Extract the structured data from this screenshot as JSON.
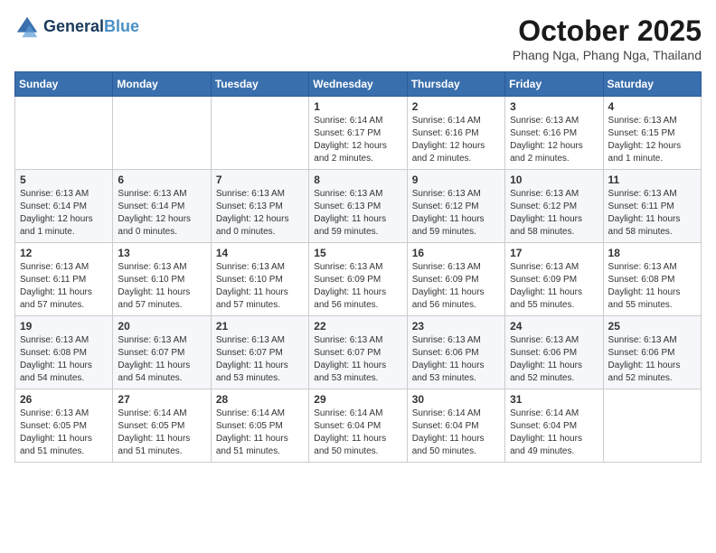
{
  "header": {
    "logo_line1": "General",
    "logo_line2": "Blue",
    "month": "October 2025",
    "location": "Phang Nga, Phang Nga, Thailand"
  },
  "weekdays": [
    "Sunday",
    "Monday",
    "Tuesday",
    "Wednesday",
    "Thursday",
    "Friday",
    "Saturday"
  ],
  "weeks": [
    [
      {
        "day": "",
        "content": ""
      },
      {
        "day": "",
        "content": ""
      },
      {
        "day": "",
        "content": ""
      },
      {
        "day": "1",
        "content": "Sunrise: 6:14 AM\nSunset: 6:17 PM\nDaylight: 12 hours and 2 minutes."
      },
      {
        "day": "2",
        "content": "Sunrise: 6:14 AM\nSunset: 6:16 PM\nDaylight: 12 hours and 2 minutes."
      },
      {
        "day": "3",
        "content": "Sunrise: 6:13 AM\nSunset: 6:16 PM\nDaylight: 12 hours and 2 minutes."
      },
      {
        "day": "4",
        "content": "Sunrise: 6:13 AM\nSunset: 6:15 PM\nDaylight: 12 hours and 1 minute."
      }
    ],
    [
      {
        "day": "5",
        "content": "Sunrise: 6:13 AM\nSunset: 6:14 PM\nDaylight: 12 hours and 1 minute."
      },
      {
        "day": "6",
        "content": "Sunrise: 6:13 AM\nSunset: 6:14 PM\nDaylight: 12 hours and 0 minutes."
      },
      {
        "day": "7",
        "content": "Sunrise: 6:13 AM\nSunset: 6:13 PM\nDaylight: 12 hours and 0 minutes."
      },
      {
        "day": "8",
        "content": "Sunrise: 6:13 AM\nSunset: 6:13 PM\nDaylight: 11 hours and 59 minutes."
      },
      {
        "day": "9",
        "content": "Sunrise: 6:13 AM\nSunset: 6:12 PM\nDaylight: 11 hours and 59 minutes."
      },
      {
        "day": "10",
        "content": "Sunrise: 6:13 AM\nSunset: 6:12 PM\nDaylight: 11 hours and 58 minutes."
      },
      {
        "day": "11",
        "content": "Sunrise: 6:13 AM\nSunset: 6:11 PM\nDaylight: 11 hours and 58 minutes."
      }
    ],
    [
      {
        "day": "12",
        "content": "Sunrise: 6:13 AM\nSunset: 6:11 PM\nDaylight: 11 hours and 57 minutes."
      },
      {
        "day": "13",
        "content": "Sunrise: 6:13 AM\nSunset: 6:10 PM\nDaylight: 11 hours and 57 minutes."
      },
      {
        "day": "14",
        "content": "Sunrise: 6:13 AM\nSunset: 6:10 PM\nDaylight: 11 hours and 57 minutes."
      },
      {
        "day": "15",
        "content": "Sunrise: 6:13 AM\nSunset: 6:09 PM\nDaylight: 11 hours and 56 minutes."
      },
      {
        "day": "16",
        "content": "Sunrise: 6:13 AM\nSunset: 6:09 PM\nDaylight: 11 hours and 56 minutes."
      },
      {
        "day": "17",
        "content": "Sunrise: 6:13 AM\nSunset: 6:09 PM\nDaylight: 11 hours and 55 minutes."
      },
      {
        "day": "18",
        "content": "Sunrise: 6:13 AM\nSunset: 6:08 PM\nDaylight: 11 hours and 55 minutes."
      }
    ],
    [
      {
        "day": "19",
        "content": "Sunrise: 6:13 AM\nSunset: 6:08 PM\nDaylight: 11 hours and 54 minutes."
      },
      {
        "day": "20",
        "content": "Sunrise: 6:13 AM\nSunset: 6:07 PM\nDaylight: 11 hours and 54 minutes."
      },
      {
        "day": "21",
        "content": "Sunrise: 6:13 AM\nSunset: 6:07 PM\nDaylight: 11 hours and 53 minutes."
      },
      {
        "day": "22",
        "content": "Sunrise: 6:13 AM\nSunset: 6:07 PM\nDaylight: 11 hours and 53 minutes."
      },
      {
        "day": "23",
        "content": "Sunrise: 6:13 AM\nSunset: 6:06 PM\nDaylight: 11 hours and 53 minutes."
      },
      {
        "day": "24",
        "content": "Sunrise: 6:13 AM\nSunset: 6:06 PM\nDaylight: 11 hours and 52 minutes."
      },
      {
        "day": "25",
        "content": "Sunrise: 6:13 AM\nSunset: 6:06 PM\nDaylight: 11 hours and 52 minutes."
      }
    ],
    [
      {
        "day": "26",
        "content": "Sunrise: 6:13 AM\nSunset: 6:05 PM\nDaylight: 11 hours and 51 minutes."
      },
      {
        "day": "27",
        "content": "Sunrise: 6:14 AM\nSunset: 6:05 PM\nDaylight: 11 hours and 51 minutes."
      },
      {
        "day": "28",
        "content": "Sunrise: 6:14 AM\nSunset: 6:05 PM\nDaylight: 11 hours and 51 minutes."
      },
      {
        "day": "29",
        "content": "Sunrise: 6:14 AM\nSunset: 6:04 PM\nDaylight: 11 hours and 50 minutes."
      },
      {
        "day": "30",
        "content": "Sunrise: 6:14 AM\nSunset: 6:04 PM\nDaylight: 11 hours and 50 minutes."
      },
      {
        "day": "31",
        "content": "Sunrise: 6:14 AM\nSunset: 6:04 PM\nDaylight: 11 hours and 49 minutes."
      },
      {
        "day": "",
        "content": ""
      }
    ]
  ]
}
